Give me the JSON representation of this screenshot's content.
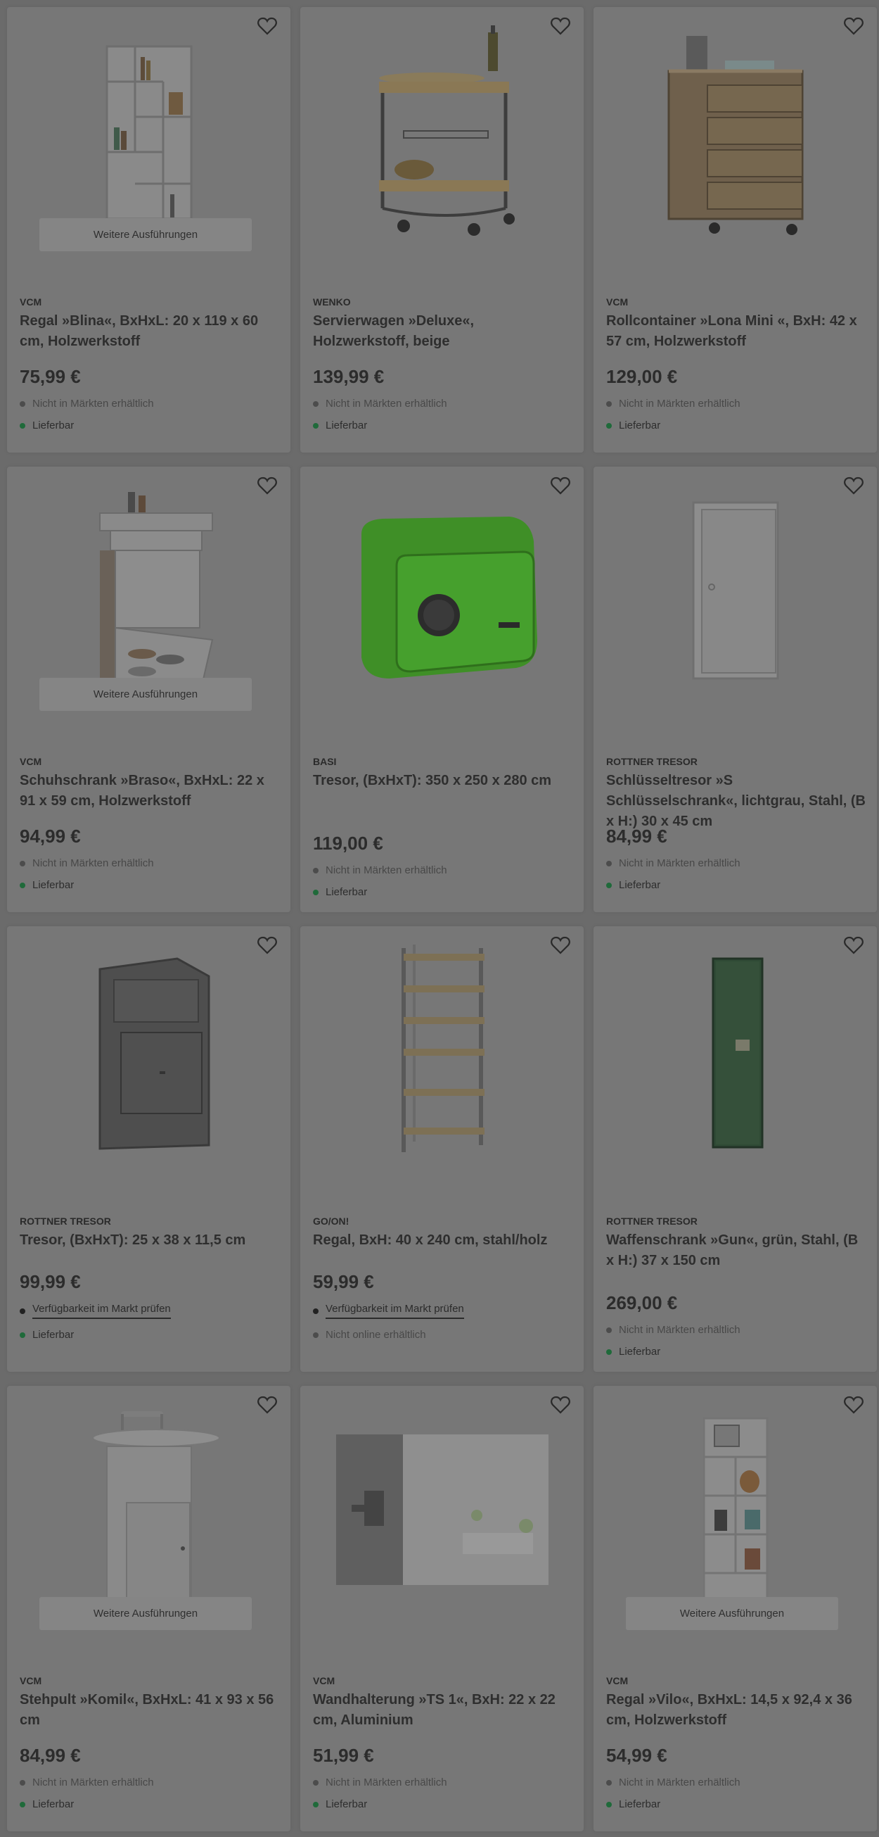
{
  "labels": {
    "variants": "Weitere Ausführungen"
  },
  "products": [
    {
      "brand": "VCM",
      "title": "Regal »Blina«, BxHxL: 20 x 119 x 60 cm, Holzwerkstoff",
      "price": "75,99 €",
      "store": "Nicht in Märkten erhältlich",
      "online": "Lieferbar",
      "variants": true,
      "icon": "shelf-image"
    },
    {
      "brand": "WENKO",
      "title": "Servierwagen »Deluxe«, Holzwerkstoff, beige",
      "price": "139,99 €",
      "store": "Nicht in Märkten erhältlich",
      "online": "Lieferbar",
      "variants": false,
      "icon": "serving-cart-image"
    },
    {
      "brand": "VCM",
      "title": "Rollcontainer »Lona Mini «, BxH: 42 x 57 cm, Holzwerkstoff",
      "price": "129,00 €",
      "store": "Nicht in Märkten erhältlich",
      "online": "Lieferbar",
      "variants": false,
      "icon": "rolling-container-image"
    },
    {
      "brand": "VCM",
      "title": "Schuhschrank »Braso«, BxHxL: 22 x 91 x 59 cm, Holzwerkstoff",
      "price": "94,99 €",
      "store": "Nicht in Märkten erhältlich",
      "online": "Lieferbar",
      "variants": true,
      "icon": "shoe-cabinet-image"
    },
    {
      "brand": "BASI",
      "title": "Tresor, (BxHxT): 350 x 250 x 280 cm",
      "price": "119,00 €",
      "store": "Nicht in Märkten erhältlich",
      "online": "Lieferbar",
      "variants": false,
      "icon": "green-safe-image"
    },
    {
      "brand": "ROTTNER TRESOR",
      "title": "Schlüsseltresor »S Schlüsselschrank«, lichtgrau, Stahl, (B x H:) 30 x 45 cm",
      "price": "84,99 €",
      "store": "Nicht in Märkten erhältlich",
      "online": "Lieferbar",
      "variants": false,
      "icon": "key-safe-image"
    },
    {
      "brand": "ROTTNER TRESOR",
      "title": "Tresor, (BxHxT): 25 x 38 x 11,5 cm",
      "price": "99,99 €",
      "store": "Verfügbarkeit im Markt prüfen",
      "online": "Lieferbar",
      "variants": false,
      "icon": "mailbox-safe-image",
      "storeLink": true
    },
    {
      "brand": "GO/ON!",
      "title": "Regal, BxH: 40 x 240 cm, stahl/holz",
      "price": "59,99 €",
      "store": "Verfügbarkeit im Markt prüfen",
      "online": "Nicht online erhältlich",
      "variants": false,
      "icon": "metal-shelf-image",
      "storeLink": true,
      "onlineMuted": true
    },
    {
      "brand": "ROTTNER TRESOR",
      "title": "Waffenschrank »Gun«, grün, Stahl, (B x H:) 37 x 150 cm",
      "price": "269,00 €",
      "store": "Nicht in Märkten erhältlich",
      "online": "Lieferbar",
      "variants": false,
      "icon": "gun-cabinet-image"
    },
    {
      "brand": "VCM",
      "title": "Stehpult »Komil«, BxHxL: 41 x 93 x 56 cm",
      "price": "84,99 €",
      "store": "Nicht in Märkten erhältlich",
      "online": "Lieferbar",
      "variants": true,
      "icon": "standing-desk-image"
    },
    {
      "brand": "VCM",
      "title": "Wandhalterung »TS 1«, BxH: 22 x 22 cm, Aluminium",
      "price": "51,99 €",
      "store": "Nicht in Märkten erhältlich",
      "online": "Lieferbar",
      "variants": false,
      "icon": "wall-mount-image"
    },
    {
      "brand": "VCM",
      "title": "Regal »Vilo«, BxHxL: 14,5 x 92,4 x 36 cm, Holzwerkstoff",
      "price": "54,99 €",
      "store": "Nicht in Märkten erhältlich",
      "online": "Lieferbar",
      "variants": true,
      "icon": "narrow-shelf-image"
    }
  ],
  "colors": {
    "overlay": "#6b6b6b",
    "card": "#777777",
    "available": "#1f6a3a",
    "safe_green": "#3f8f27"
  }
}
